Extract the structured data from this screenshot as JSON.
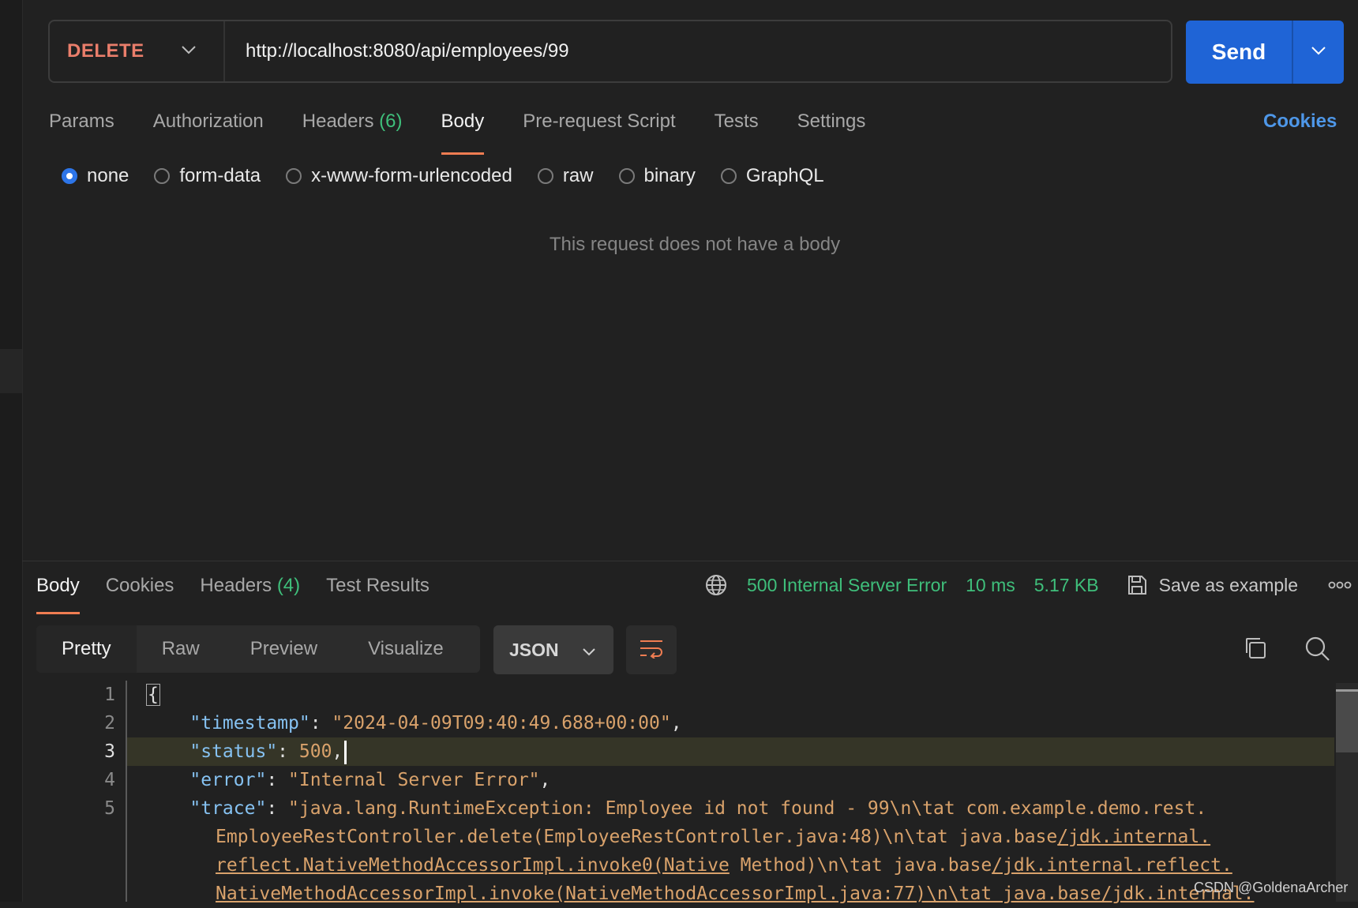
{
  "request": {
    "method": "DELETE",
    "url": "http://localhost:8080/api/employees/99",
    "send_label": "Send"
  },
  "request_tabs": [
    {
      "label": "Params",
      "count": ""
    },
    {
      "label": "Authorization",
      "count": ""
    },
    {
      "label": "Headers",
      "count": "(6)"
    },
    {
      "label": "Body",
      "count": ""
    },
    {
      "label": "Pre-request Script",
      "count": ""
    },
    {
      "label": "Tests",
      "count": ""
    },
    {
      "label": "Settings",
      "count": ""
    }
  ],
  "cookies_link": "Cookies",
  "body_types": [
    "none",
    "form-data",
    "x-www-form-urlencoded",
    "raw",
    "binary",
    "GraphQL"
  ],
  "selected_body_type": "none",
  "empty_body_message": "This request does not have a body",
  "response": {
    "tabs": [
      {
        "label": "Body",
        "count": ""
      },
      {
        "label": "Cookies",
        "count": ""
      },
      {
        "label": "Headers",
        "count": "(4)"
      },
      {
        "label": "Test Results",
        "count": ""
      }
    ],
    "status": "500 Internal Server Error",
    "time": "10 ms",
    "size": "5.17 KB",
    "save_example": "Save as example",
    "view_modes": [
      "Pretty",
      "Raw",
      "Preview",
      "Visualize"
    ],
    "format": "JSON",
    "line_numbers": [
      "1",
      "2",
      "3",
      "4",
      "5"
    ],
    "json": {
      "open_brace": "{",
      "timestamp_key": "\"timestamp\"",
      "timestamp_value": "\"2024-04-09T09:40:49.688+00:00\"",
      "status_key": "\"status\"",
      "status_value": "500",
      "error_key": "\"error\"",
      "error_value": "\"Internal Server Error\"",
      "trace_key": "\"trace\"",
      "trace_line1": "\"java.lang.RuntimeException: Employee id not found - 99\\n\\tat com.example.demo.rest.",
      "trace_line2a": "EmployeeRestController.delete(EmployeeRestController.java:48)\\n\\tat java.base",
      "trace_line2b": "/jdk.internal.",
      "trace_line3a": "reflect.NativeMethodAccessorImpl.invoke0(Native",
      "trace_line3b": " Method)\\n\\tat java.base",
      "trace_line3c": "/jdk.internal.reflect.",
      "trace_line4": "NativeMethodAccessorImpl.invoke(NativeMethodAccessorImpl.java:77)\\n\\tat java.base/jdk.internal."
    }
  },
  "watermark": "CSDN @GoldenaArcher",
  "colors": {
    "accent": "#1f64d6",
    "method": "#ea7e6b",
    "success_text": "#3fbf7b",
    "tab_underline": "#ef7d52"
  }
}
